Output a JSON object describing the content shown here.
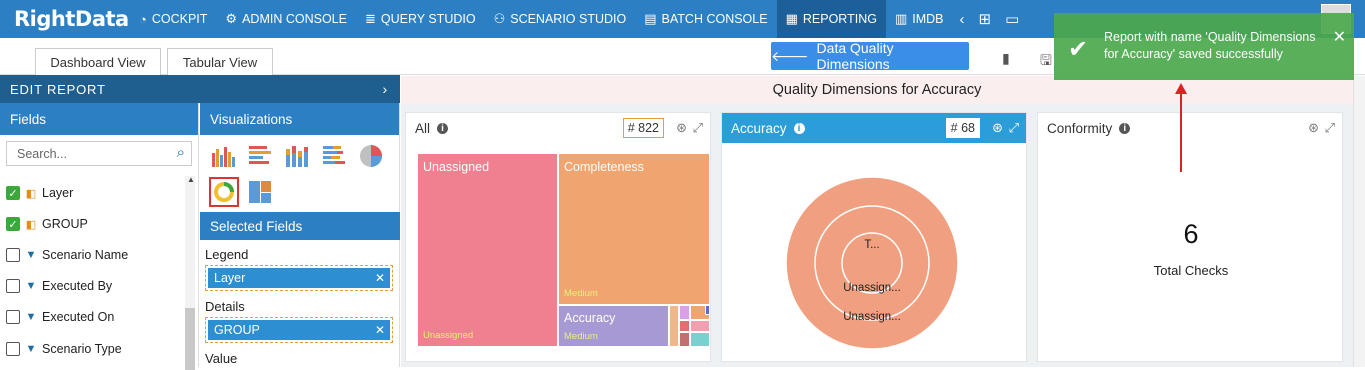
{
  "app": {
    "logo": "RightData"
  },
  "nav": {
    "items": [
      {
        "label": "COCKPIT",
        "icon": "gauge-icon"
      },
      {
        "label": "ADMIN CONSOLE",
        "icon": "gear-icon"
      },
      {
        "label": "QUERY STUDIO",
        "icon": "database-icon"
      },
      {
        "label": "SCENARIO STUDIO",
        "icon": "toggles-icon"
      },
      {
        "label": "BATCH CONSOLE",
        "icon": "batch-icon"
      },
      {
        "label": "REPORTING",
        "icon": "report-icon"
      },
      {
        "label": "IMDB",
        "icon": "columns-icon"
      }
    ],
    "active": "REPORTING"
  },
  "tabs": {
    "dashboard": "Dashboard View",
    "tabular": "Tabular View"
  },
  "dqd_button": "Data Quality Dimensions",
  "edit_report": {
    "title": "EDIT REPORT"
  },
  "fields": {
    "header": "Fields",
    "search_placeholder": "Search...",
    "items": [
      {
        "label": "Layer",
        "checked": true
      },
      {
        "label": "GROUP",
        "checked": true
      },
      {
        "label": "Scenario Name",
        "checked": false
      },
      {
        "label": "Executed By",
        "checked": false
      },
      {
        "label": "Executed On",
        "checked": false
      },
      {
        "label": "Scenario Type",
        "checked": false
      }
    ]
  },
  "visualizations": {
    "header": "Visualizations",
    "selected_header": "Selected Fields",
    "legend_label": "Legend",
    "legend_value": "Layer",
    "details_label": "Details",
    "details_value": "GROUP",
    "value_label": "Value"
  },
  "main": {
    "title": "Quality Dimensions for Accuracy",
    "cards": [
      {
        "title": "All",
        "count": "# 822"
      },
      {
        "title": "Accuracy",
        "count": "# 68"
      },
      {
        "title": "Conformity",
        "value": "6",
        "value_label": "Total Checks"
      }
    ],
    "treemap": {
      "unassigned": "Unassigned",
      "unassigned_sub": "Unassigned",
      "completeness": "Completeness",
      "completeness_sub": "Medium",
      "accuracy": "Accuracy",
      "accuracy_sub": "Medium"
    },
    "donut": {
      "inner": "T...",
      "middle": "Unassign...",
      "outer": "Unassign..."
    }
  },
  "toast": {
    "message": "Report with name 'Quality Dimensions for Accuracy' saved successfully"
  },
  "colors": {
    "nav": "#2b7fc2",
    "accent": "#2b9ed9",
    "toast": "#4ca84c",
    "treemap_pink": "#f0808f",
    "treemap_orange": "#f0a470",
    "treemap_purple": "#a79ad4"
  }
}
